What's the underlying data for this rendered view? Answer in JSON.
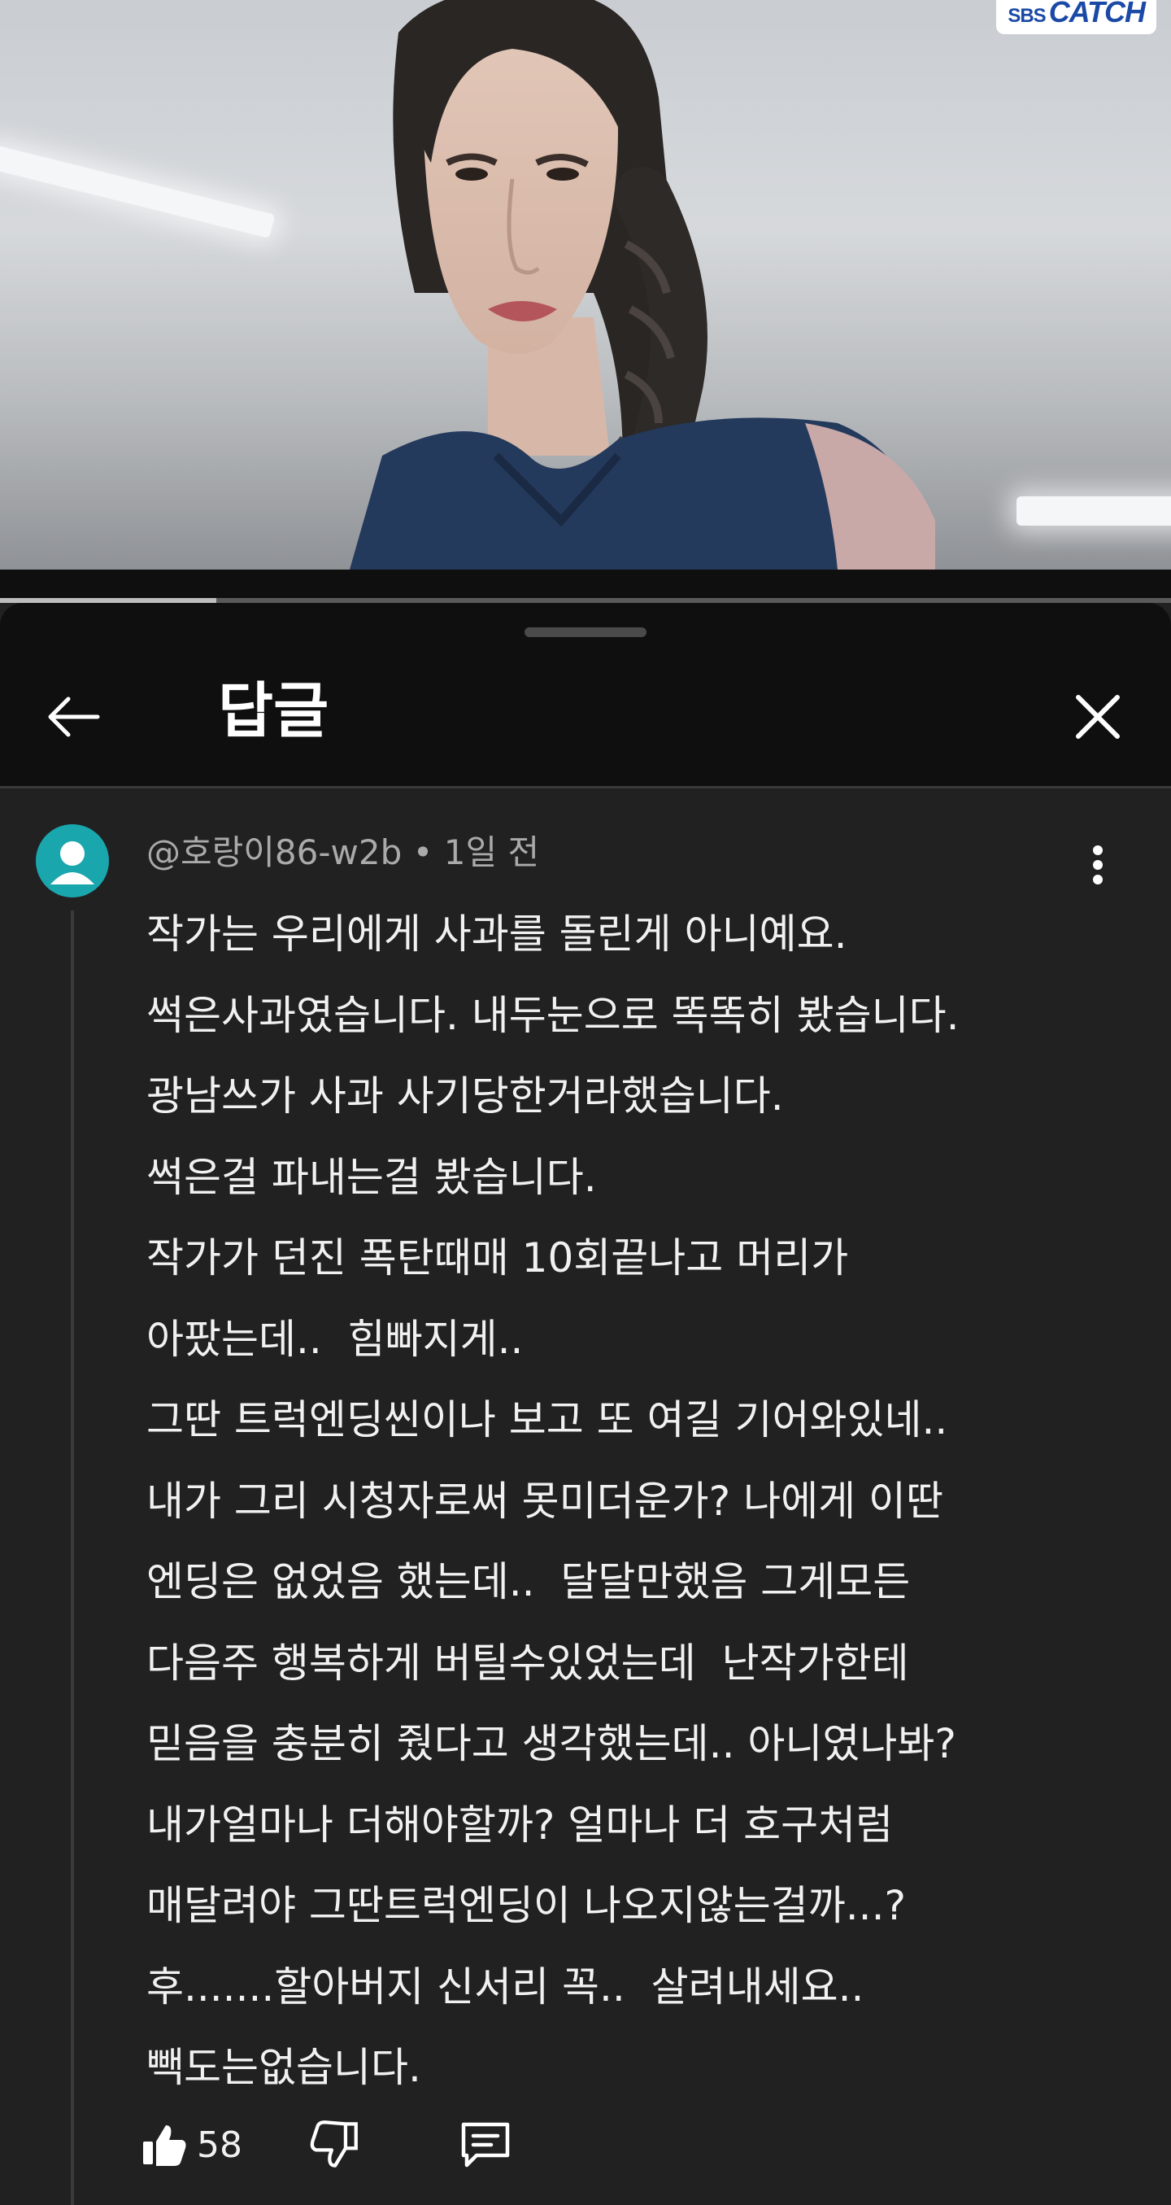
{
  "video": {
    "watermark_prefix": "SBS",
    "watermark_main": "CATCH",
    "progress_fraction": 0.185
  },
  "panel": {
    "title": "답글"
  },
  "comment": {
    "author": "@호랑이86-w2b",
    "separator": "•",
    "time": "1일 전",
    "lines": [
      "작가는 우리에게 사과를 돌린게 아니예요.",
      "썩은사과였습니다. 내두눈으로 똑똑히 봤습니다.",
      "광남쓰가 사과 사기당한거라했습니다.",
      "썩은걸 파내는걸 봤습니다.",
      "작가가 던진 폭탄때매 10회끝나고 머리가",
      "아팠는데..  힘빠지게..",
      "그딴 트럭엔딩씬이나 보고 또 여길 기어와있네..",
      "내가 그리 시청자로써 못미더운가? 나에게 이딴",
      "엔딩은 없었음 했는데..  달달만했음 그게모든",
      "다음주 행복하게 버틸수있었는데  난작가한테",
      "믿음을 충분히 줬다고 생각했는데.. 아니였나봐?",
      "내가얼마나 더해야할까? 얼마나 더 호구처럼",
      "매달려야 그딴트럭엔딩이 나오지않는걸까...?",
      "후.......할아버지 신서리 꼭..  살려내세요..",
      "빽도는없습니다."
    ],
    "like_count": "58"
  },
  "icons": {
    "back": "arrow-left-icon",
    "close": "close-icon",
    "more": "more-vert-icon",
    "like": "thumb-up-icon",
    "dislike": "thumb-down-icon",
    "reply": "comment-icon",
    "avatar": "default-avatar-icon"
  },
  "colors": {
    "avatar_bg": "#1aa6ad",
    "header_bg": "#0f0f0f",
    "panel_bg": "#212121",
    "watermark_text": "#1b4aa6"
  }
}
